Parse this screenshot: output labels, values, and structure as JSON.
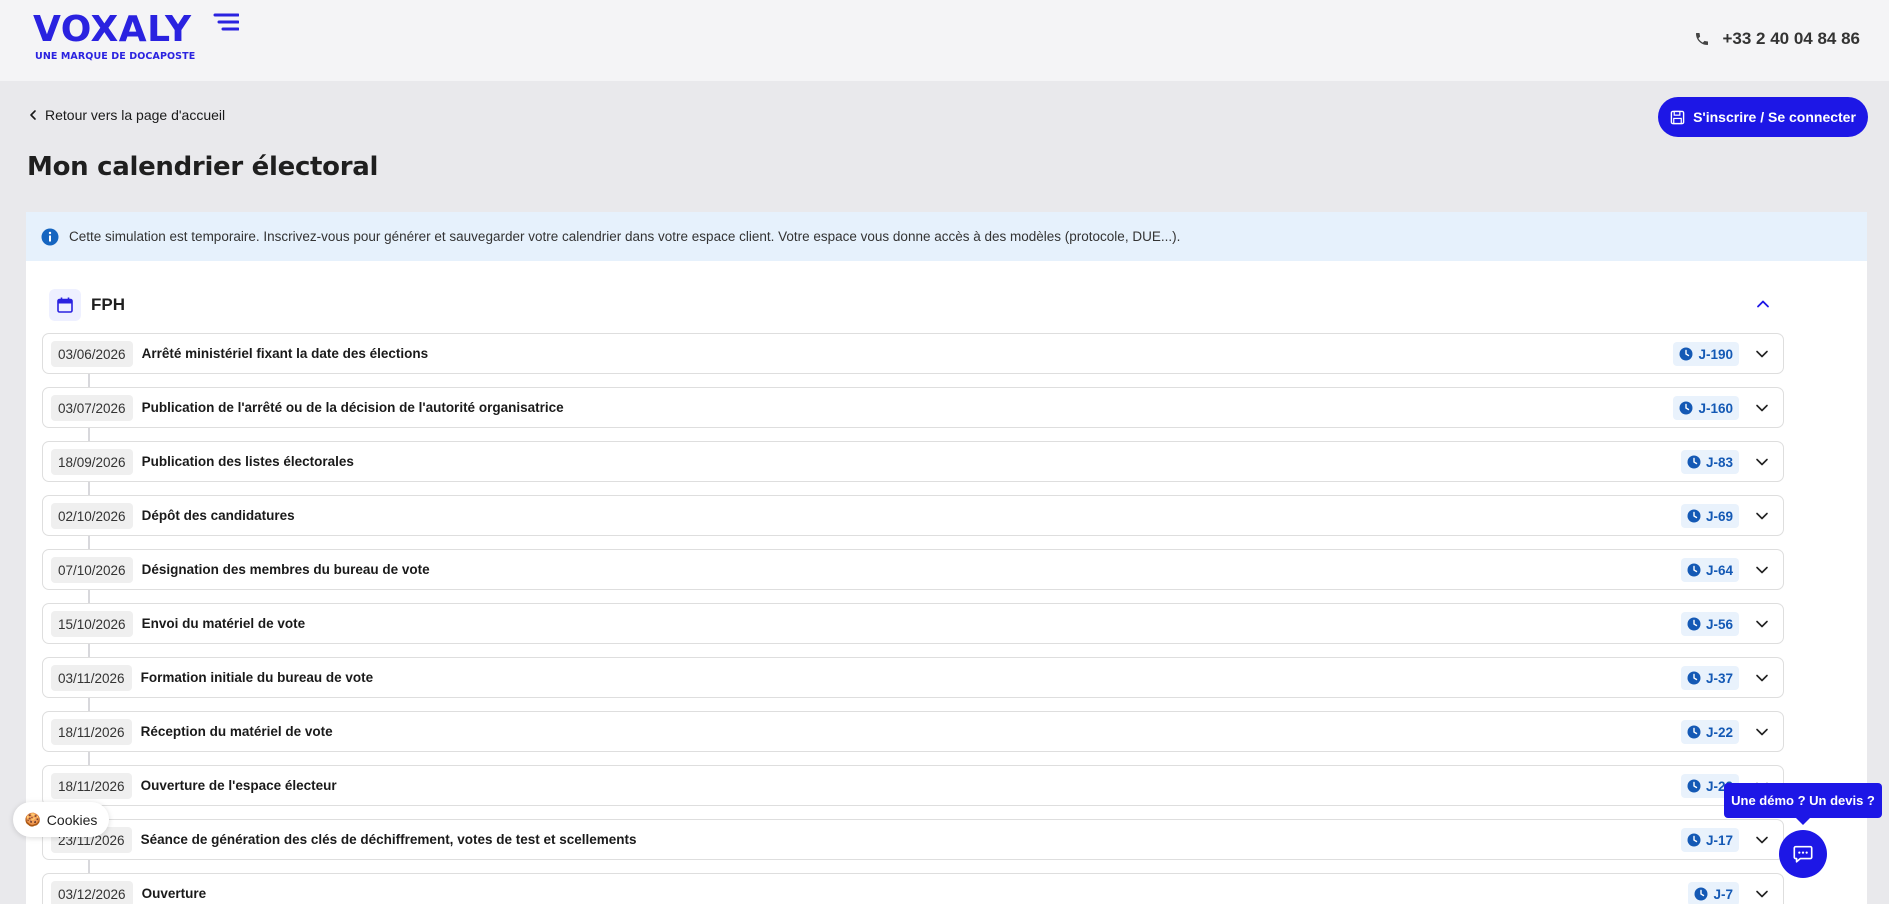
{
  "header": {
    "logo_text": "VOXALY",
    "logo_tagline": "UNE MARQUE DE DOCAPOSTE",
    "phone": "+33 2 40 04 84 86"
  },
  "nav": {
    "back_label": "Retour vers la page d'accueil",
    "auth_label": "S'inscrire / Se connecter"
  },
  "page": {
    "title": "Mon calendrier électoral"
  },
  "info_banner": {
    "text": "Cette simulation est temporaire. Inscrivez-vous pour générer et sauvegarder votre calendrier dans votre espace client. Votre espace vous donne accès à des modèles (protocole, DUE...)."
  },
  "section": {
    "title": "FPH"
  },
  "steps": [
    {
      "date": "03/06/2026",
      "label": "Arrêté ministériel fixant la date des élections",
      "badge": "J-190"
    },
    {
      "date": "03/07/2026",
      "label": "Publication de l'arrêté ou de la décision de l'autorité organisatrice",
      "badge": "J-160"
    },
    {
      "date": "18/09/2026",
      "label": "Publication des listes électorales",
      "badge": "J-83"
    },
    {
      "date": "02/10/2026",
      "label": "Dépôt des candidatures",
      "badge": "J-69"
    },
    {
      "date": "07/10/2026",
      "label": "Désignation des membres du bureau de vote",
      "badge": "J-64"
    },
    {
      "date": "15/10/2026",
      "label": "Envoi du matériel de vote",
      "badge": "J-56"
    },
    {
      "date": "03/11/2026",
      "label": "Formation initiale du bureau de vote",
      "badge": "J-37"
    },
    {
      "date": "18/11/2026",
      "label": "Réception du matériel de vote",
      "badge": "J-22"
    },
    {
      "date": "18/11/2026",
      "label": "Ouverture de l'espace électeur",
      "badge": "J-22"
    },
    {
      "date": "23/11/2026",
      "label": "Séance de génération des clés de déchiffrement, votes de test et scellements",
      "badge": "J-17"
    },
    {
      "date": "03/12/2026",
      "label": "Ouverture",
      "badge": "J-7"
    }
  ],
  "widgets": {
    "cookies_label": "Cookies",
    "demo_label": "Une démo ? Un devis ?"
  },
  "colors": {
    "brand": "#1d17e6",
    "info_bg": "#e6f1fc",
    "badge_text": "#1459b5"
  }
}
